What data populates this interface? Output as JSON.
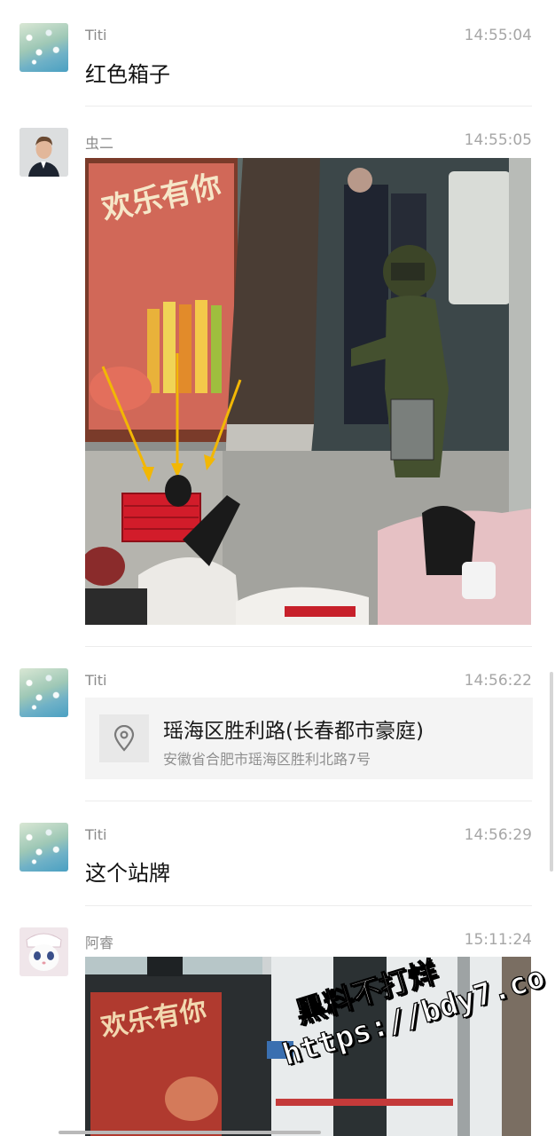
{
  "messages": [
    {
      "sender": "Titi",
      "time": "14:55:04",
      "text": "红色箱子",
      "avatar": "flowers-avatar"
    },
    {
      "sender": "虫二",
      "time": "14:55:05",
      "image": "photo-bomb-disposal-scene",
      "avatar": "man-avatar"
    },
    {
      "sender": "Titi",
      "time": "14:56:22",
      "avatar": "flowers-avatar",
      "location": {
        "title": "瑶海区胜利路(长春都市豪庭)",
        "address": "安徽省合肥市瑶海区胜利北路7号",
        "icon": "location-pin-icon"
      }
    },
    {
      "sender": "Titi",
      "time": "14:56:29",
      "text": "这个站牌",
      "avatar": "flowers-avatar"
    },
    {
      "sender": "阿睿",
      "time": "15:11:24",
      "image": "photo-bus-stop-sign",
      "avatar": "cat-avatar"
    }
  ],
  "watermark": {
    "line1": "黑料不打烊",
    "line2": "https://bdy7.co"
  },
  "colors": {
    "accent_arrow": "#f2b705",
    "red_box": "#d21c2a",
    "suit_green": "#44502f"
  }
}
